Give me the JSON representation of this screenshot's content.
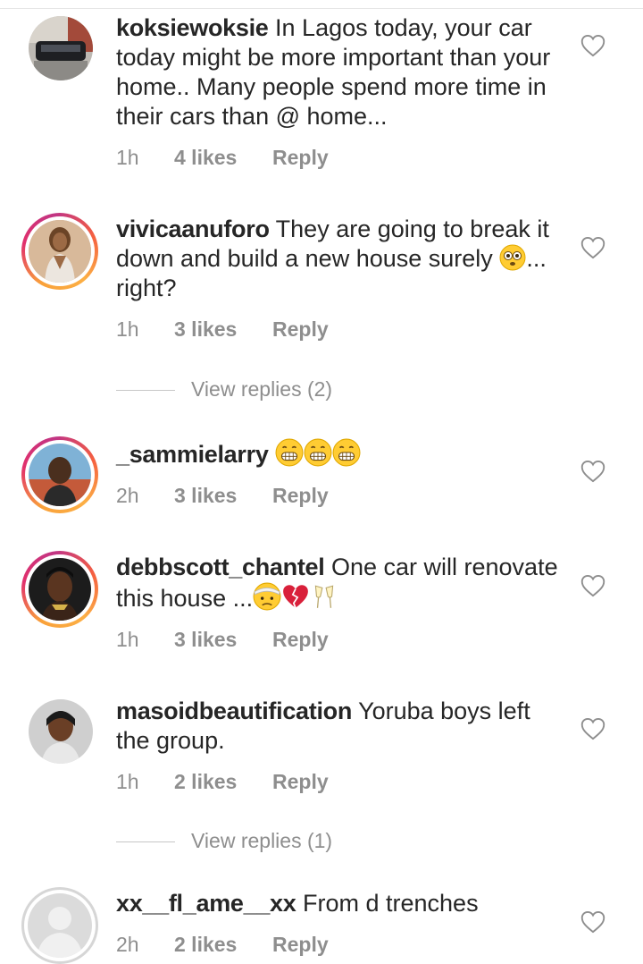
{
  "comments": [
    {
      "username": "koksiewoksie",
      "text": "In Lagos today, your car today might be more important than your home.. Many people spend more time in their cars than @ home...",
      "time": "1h",
      "likes": "4 likes",
      "reply": "Reply"
    },
    {
      "username": "vivicaanuforo",
      "text": "They are going to break it down and build a new house surely",
      "text_after_emoji": "... right?",
      "emoji": "flushed-face-emoji",
      "time": "1h",
      "likes": "3 likes",
      "reply": "Reply",
      "view_replies": "View replies (2)"
    },
    {
      "username": "_sammielarry",
      "emoji": "grinning-face-emoji",
      "time": "2h",
      "likes": "3 likes",
      "reply": "Reply"
    },
    {
      "username": "debbscott_chantel",
      "text": "One car will renovate this house ...",
      "emojis": [
        "head-bandage-face-emoji",
        "broken-heart-emoji",
        "clinking-glasses-emoji"
      ],
      "time": "1h",
      "likes": "3 likes",
      "reply": "Reply"
    },
    {
      "username": "masoidbeautification",
      "text": "Yoruba boys left the group.",
      "time": "1h",
      "likes": "2 likes",
      "reply": "Reply",
      "view_replies": "View replies (1)"
    },
    {
      "username": "xx__fl_ame__xx",
      "text": "From d trenches",
      "time": "2h",
      "likes": "2 likes",
      "reply": "Reply"
    }
  ],
  "icons": {
    "like": "heart-outline-icon"
  },
  "colors": {
    "text": "#262626",
    "secondary": "#8e8e8e",
    "story_ring_start": "#f9a13a",
    "story_ring_end": "#c13584"
  }
}
